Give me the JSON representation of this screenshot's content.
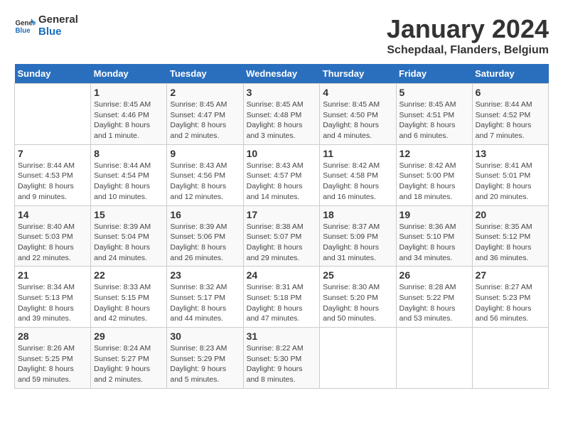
{
  "logo": {
    "general": "General",
    "blue": "Blue"
  },
  "title": "January 2024",
  "location": "Schepdaal, Flanders, Belgium",
  "days_of_week": [
    "Sunday",
    "Monday",
    "Tuesday",
    "Wednesday",
    "Thursday",
    "Friday",
    "Saturday"
  ],
  "weeks": [
    [
      {
        "day": "",
        "info": ""
      },
      {
        "day": "1",
        "info": "Sunrise: 8:45 AM\nSunset: 4:46 PM\nDaylight: 8 hours\nand 1 minute."
      },
      {
        "day": "2",
        "info": "Sunrise: 8:45 AM\nSunset: 4:47 PM\nDaylight: 8 hours\nand 2 minutes."
      },
      {
        "day": "3",
        "info": "Sunrise: 8:45 AM\nSunset: 4:48 PM\nDaylight: 8 hours\nand 3 minutes."
      },
      {
        "day": "4",
        "info": "Sunrise: 8:45 AM\nSunset: 4:50 PM\nDaylight: 8 hours\nand 4 minutes."
      },
      {
        "day": "5",
        "info": "Sunrise: 8:45 AM\nSunset: 4:51 PM\nDaylight: 8 hours\nand 6 minutes."
      },
      {
        "day": "6",
        "info": "Sunrise: 8:44 AM\nSunset: 4:52 PM\nDaylight: 8 hours\nand 7 minutes."
      }
    ],
    [
      {
        "day": "7",
        "info": "Sunrise: 8:44 AM\nSunset: 4:53 PM\nDaylight: 8 hours\nand 9 minutes."
      },
      {
        "day": "8",
        "info": "Sunrise: 8:44 AM\nSunset: 4:54 PM\nDaylight: 8 hours\nand 10 minutes."
      },
      {
        "day": "9",
        "info": "Sunrise: 8:43 AM\nSunset: 4:56 PM\nDaylight: 8 hours\nand 12 minutes."
      },
      {
        "day": "10",
        "info": "Sunrise: 8:43 AM\nSunset: 4:57 PM\nDaylight: 8 hours\nand 14 minutes."
      },
      {
        "day": "11",
        "info": "Sunrise: 8:42 AM\nSunset: 4:58 PM\nDaylight: 8 hours\nand 16 minutes."
      },
      {
        "day": "12",
        "info": "Sunrise: 8:42 AM\nSunset: 5:00 PM\nDaylight: 8 hours\nand 18 minutes."
      },
      {
        "day": "13",
        "info": "Sunrise: 8:41 AM\nSunset: 5:01 PM\nDaylight: 8 hours\nand 20 minutes."
      }
    ],
    [
      {
        "day": "14",
        "info": "Sunrise: 8:40 AM\nSunset: 5:03 PM\nDaylight: 8 hours\nand 22 minutes."
      },
      {
        "day": "15",
        "info": "Sunrise: 8:39 AM\nSunset: 5:04 PM\nDaylight: 8 hours\nand 24 minutes."
      },
      {
        "day": "16",
        "info": "Sunrise: 8:39 AM\nSunset: 5:06 PM\nDaylight: 8 hours\nand 26 minutes."
      },
      {
        "day": "17",
        "info": "Sunrise: 8:38 AM\nSunset: 5:07 PM\nDaylight: 8 hours\nand 29 minutes."
      },
      {
        "day": "18",
        "info": "Sunrise: 8:37 AM\nSunset: 5:09 PM\nDaylight: 8 hours\nand 31 minutes."
      },
      {
        "day": "19",
        "info": "Sunrise: 8:36 AM\nSunset: 5:10 PM\nDaylight: 8 hours\nand 34 minutes."
      },
      {
        "day": "20",
        "info": "Sunrise: 8:35 AM\nSunset: 5:12 PM\nDaylight: 8 hours\nand 36 minutes."
      }
    ],
    [
      {
        "day": "21",
        "info": "Sunrise: 8:34 AM\nSunset: 5:13 PM\nDaylight: 8 hours\nand 39 minutes."
      },
      {
        "day": "22",
        "info": "Sunrise: 8:33 AM\nSunset: 5:15 PM\nDaylight: 8 hours\nand 42 minutes."
      },
      {
        "day": "23",
        "info": "Sunrise: 8:32 AM\nSunset: 5:17 PM\nDaylight: 8 hours\nand 44 minutes."
      },
      {
        "day": "24",
        "info": "Sunrise: 8:31 AM\nSunset: 5:18 PM\nDaylight: 8 hours\nand 47 minutes."
      },
      {
        "day": "25",
        "info": "Sunrise: 8:30 AM\nSunset: 5:20 PM\nDaylight: 8 hours\nand 50 minutes."
      },
      {
        "day": "26",
        "info": "Sunrise: 8:28 AM\nSunset: 5:22 PM\nDaylight: 8 hours\nand 53 minutes."
      },
      {
        "day": "27",
        "info": "Sunrise: 8:27 AM\nSunset: 5:23 PM\nDaylight: 8 hours\nand 56 minutes."
      }
    ],
    [
      {
        "day": "28",
        "info": "Sunrise: 8:26 AM\nSunset: 5:25 PM\nDaylight: 8 hours\nand 59 minutes."
      },
      {
        "day": "29",
        "info": "Sunrise: 8:24 AM\nSunset: 5:27 PM\nDaylight: 9 hours\nand 2 minutes."
      },
      {
        "day": "30",
        "info": "Sunrise: 8:23 AM\nSunset: 5:29 PM\nDaylight: 9 hours\nand 5 minutes."
      },
      {
        "day": "31",
        "info": "Sunrise: 8:22 AM\nSunset: 5:30 PM\nDaylight: 9 hours\nand 8 minutes."
      },
      {
        "day": "",
        "info": ""
      },
      {
        "day": "",
        "info": ""
      },
      {
        "day": "",
        "info": ""
      }
    ]
  ]
}
